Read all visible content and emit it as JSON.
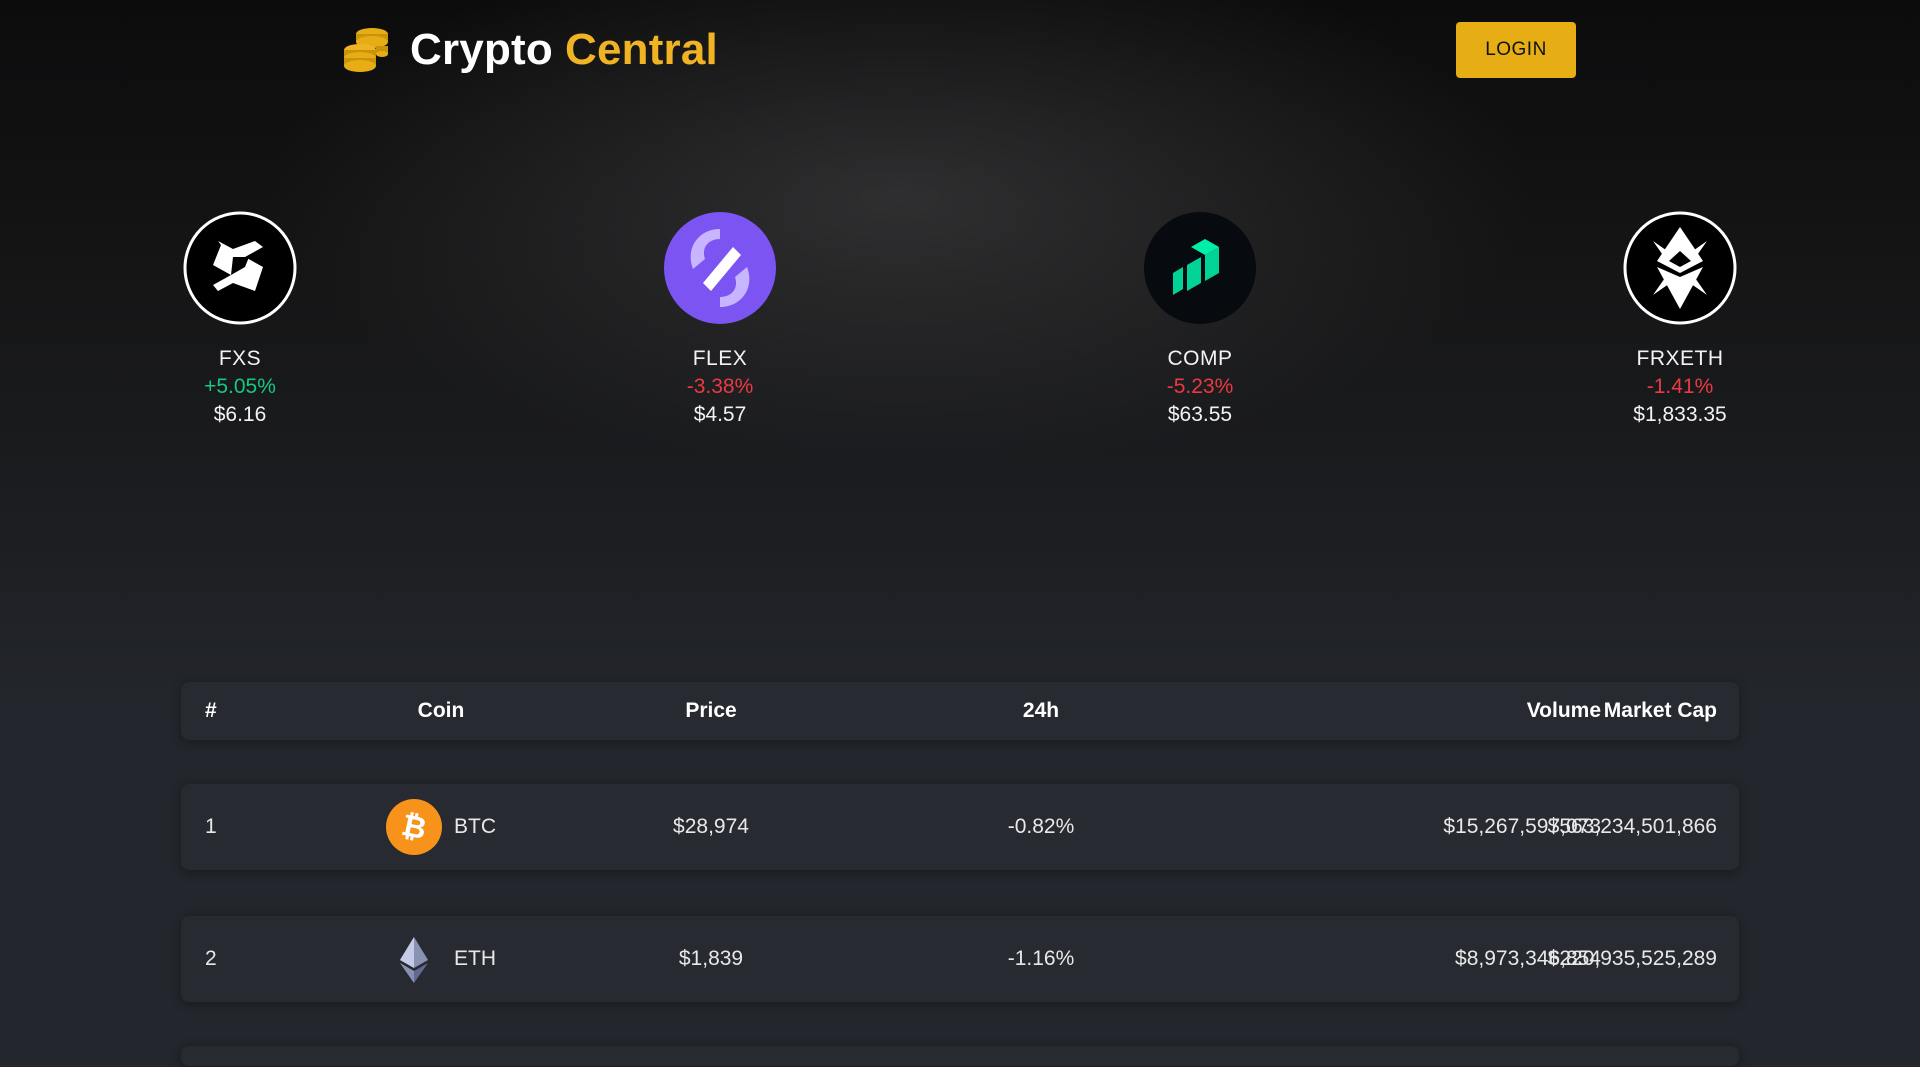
{
  "header": {
    "brand_part1": "Crypto",
    "brand_part2": "Central",
    "login_label": "LOGIN",
    "brand_color": "#f0b323",
    "logo_icon": "coins-stack-icon"
  },
  "hero": {
    "coins": [
      {
        "symbol": "FXS",
        "change": "+5.05%",
        "price": "$6.16",
        "icon": "frax-share-icon"
      },
      {
        "symbol": "FLEX",
        "change": "-3.38%",
        "price": "$4.57",
        "icon": "flex-icon"
      },
      {
        "symbol": "COMP",
        "change": "-5.23%",
        "price": "$63.55",
        "icon": "compound-icon"
      },
      {
        "symbol": "FRXETH",
        "change": "-1.41%",
        "price": "$1,833.35",
        "icon": "frax-ether-icon"
      }
    ]
  },
  "table": {
    "columns": [
      "#",
      "Coin",
      "Price",
      "24h",
      "Volume",
      "Market Cap"
    ],
    "rows": [
      {
        "rank": "1",
        "coin": "BTC",
        "price": "$28,974",
        "change": "-0.82%",
        "volume": "$15,267,597,073",
        "market_cap": "$563,234,501,866",
        "icon": "bitcoin-icon"
      },
      {
        "rank": "2",
        "coin": "ETH",
        "price": "$1,839",
        "change": "-1.16%",
        "volume": "$8,973,346,854",
        "market_cap": "$220,935,525,289",
        "icon": "ethereum-icon"
      }
    ]
  },
  "colors": {
    "up": "#16c784",
    "down": "#ea3943",
    "accent": "#e6ae14"
  }
}
